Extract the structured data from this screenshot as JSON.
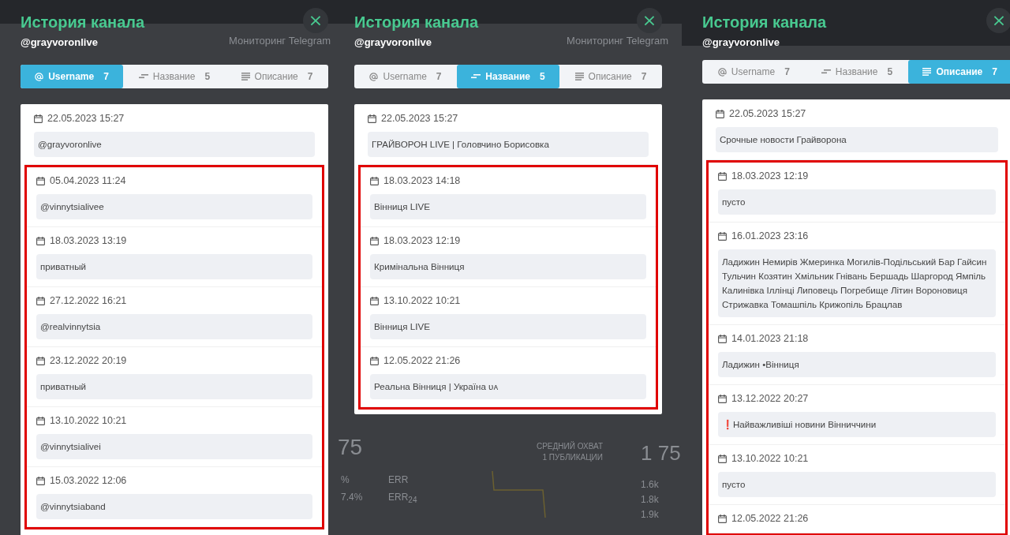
{
  "panels": [
    {
      "title": "История канала",
      "handle": "@grayvoronlive",
      "close": "×",
      "background_texts": [
        "Мониторинг Telegram"
      ],
      "tabs": [
        {
          "kind": "at",
          "label": "Username",
          "count": "7",
          "selected": true
        },
        {
          "kind": "lines",
          "label": "Название",
          "count": "5",
          "selected": false
        },
        {
          "kind": "text",
          "label": "Описание",
          "count": "7",
          "selected": false
        }
      ],
      "entries": [
        {
          "date": "22.05.2023 15:27",
          "value": "@grayvoronlive",
          "highlighted": false
        },
        {
          "date": "05.04.2023 11:24",
          "value": "@vinnytsialivee",
          "highlighted": true
        },
        {
          "date": "18.03.2023 13:19",
          "value": "приватный",
          "highlighted": true
        },
        {
          "date": "27.12.2022 16:21",
          "value": "@realvinnytsia",
          "highlighted": true
        },
        {
          "date": "23.12.2022 20:19",
          "value": "приватный",
          "highlighted": true
        },
        {
          "date": "13.10.2022 10:21",
          "value": "@vinnytsialivei",
          "highlighted": true
        },
        {
          "date": "15.03.2022 12:06",
          "value": "@vinnytsiaband",
          "highlighted": true
        }
      ]
    },
    {
      "title": "История канала",
      "handle": "@grayvoronlive",
      "close": "×",
      "background_texts": [
        "Мониторинг Telegram"
      ],
      "tabs": [
        {
          "kind": "at",
          "label": "Username",
          "count": "7",
          "selected": false
        },
        {
          "kind": "lines",
          "label": "Название",
          "count": "5",
          "selected": true
        },
        {
          "kind": "text",
          "label": "Описание",
          "count": "7",
          "selected": false
        }
      ],
      "entries": [
        {
          "date": "22.05.2023 15:27",
          "value": "ГРАЙВОРОН LIVE | Головчино Борисовка",
          "highlighted": false
        },
        {
          "date": "18.03.2023 14:18",
          "value": "Вінниця LIVE",
          "highlighted": true
        },
        {
          "date": "18.03.2023 12:19",
          "value": "Кримінальна Вінниця",
          "highlighted": true
        },
        {
          "date": "13.10.2022 10:21",
          "value": "Вінниця LIVE",
          "highlighted": true
        },
        {
          "date": "12.05.2022 21:26",
          "value": "Реальна Вінниця | Україна ᴜᴀ",
          "highlighted": true
        }
      ],
      "stats": {
        "number": "75",
        "rows": [
          {
            "value": "%",
            "label": "ERR"
          },
          {
            "value": "7.4%",
            "label": "ERR$_{24}$"
          }
        ],
        "caption": [
          "СРЕДНИЙ ОХВАТ",
          "1 ПУБЛИКАЦИИ"
        ],
        "side_number": "1 75",
        "side_values": [
          "1.6k",
          "1.8k",
          "1.9k"
        ]
      }
    },
    {
      "title": "История канала",
      "handle": "@grayvoronlive",
      "close": "×",
      "tabs": [
        {
          "kind": "at",
          "label": "Username",
          "count": "7",
          "selected": false
        },
        {
          "kind": "lines",
          "label": "Название",
          "count": "5",
          "selected": false
        },
        {
          "kind": "text",
          "label": "Описание",
          "count": "7",
          "selected": true
        }
      ],
      "entries": [
        {
          "date": "22.05.2023 15:27",
          "value": "Срочные новости Грайворона",
          "highlighted": false
        },
        {
          "date": "18.03.2023 12:19",
          "value": "пусто",
          "highlighted": true
        },
        {
          "date": "16.01.2023 23:16",
          "value": "Ладижин Немирів Жмеринка Могилів-Подільський Бар Гайсин Тульчин Козятин Хмільник Гнівань Бершадь Шаргород Ямпіль Калинівка Іллінці Липовець Погребище Літин Вороновиця Стрижавка Томашпіль Крижопіль Брацлав",
          "highlighted": true
        },
        {
          "date": "14.01.2023 21:18",
          "value": "Ладижин •Вінниця",
          "highlighted": true
        },
        {
          "date": "13.12.2022 20:27",
          "value": "❗Найважливіші новини Вінниччини",
          "highlighted": true
        },
        {
          "date": "13.10.2022 10:21",
          "value": "пусто",
          "highlighted": true
        },
        {
          "date": "12.05.2022 21:26",
          "highlighted": true
        }
      ]
    }
  ]
}
